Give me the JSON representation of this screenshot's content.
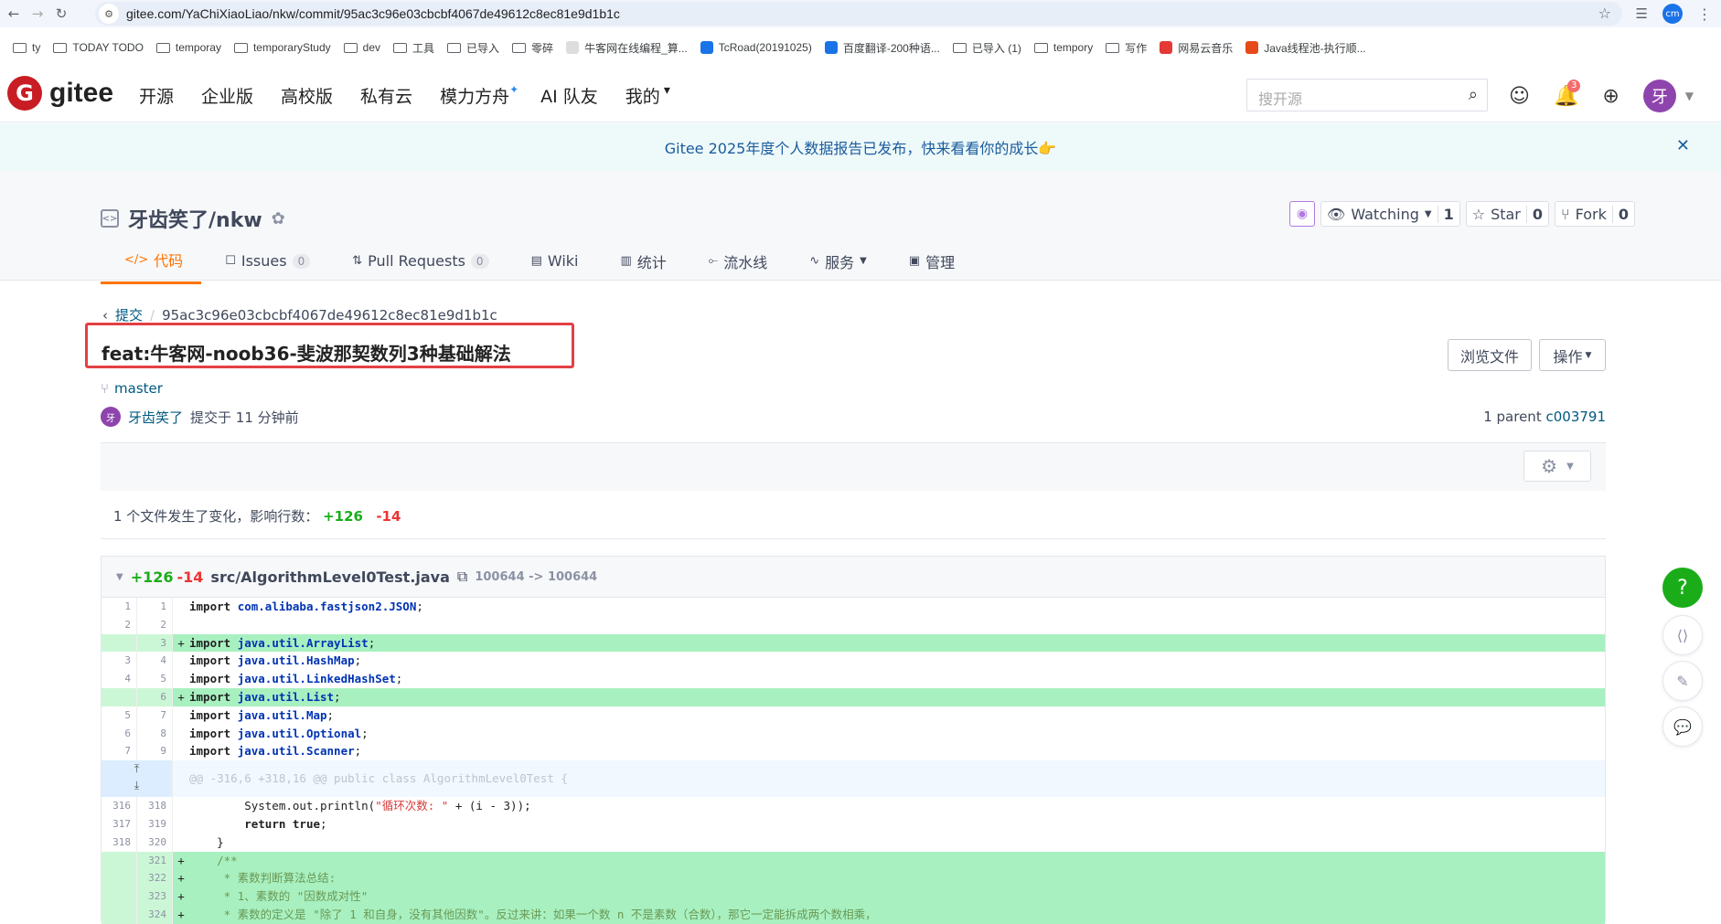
{
  "browser": {
    "url": "gitee.com/YaChiXiaoLiao/nkw/commit/95ac3c96e03cbcbf4067de49612c8ec81e9d1b1c",
    "profile": "cm",
    "bookmarks": [
      "ty",
      "TODAY TODO",
      "temporay",
      "temporaryStudy",
      "dev",
      "工具",
      "已导入",
      "零碎",
      "牛客网在线编程_算...",
      "TcRoad(20191025)",
      "百度翻译-200种语...",
      "已导入 (1)",
      "tempory",
      "写作",
      "网易云音乐",
      "Java线程池-执行顺..."
    ]
  },
  "nav": {
    "logo": "gitee",
    "items": [
      "开源",
      "企业版",
      "高校版",
      "私有云",
      "模力方舟",
      "AI 队友",
      "我的"
    ],
    "search_placeholder": "搜开源",
    "notif_count": "3",
    "user_initial": "牙"
  },
  "announce": {
    "text": "Gitee 2025年度个人数据报告已发布，快来看看你的成长👉"
  },
  "repo": {
    "title": "牙齿笑了/nkw",
    "watch_label": "Watching",
    "watch_count": "1",
    "star_label": "Star",
    "star_count": "0",
    "fork_label": "Fork",
    "fork_count": "0",
    "tabs": [
      {
        "label": "代码"
      },
      {
        "label": "Issues",
        "count": "0"
      },
      {
        "label": "Pull Requests",
        "count": "0"
      },
      {
        "label": "Wiki"
      },
      {
        "label": "统计"
      },
      {
        "label": "流水线"
      },
      {
        "label": "服务"
      },
      {
        "label": "管理"
      }
    ]
  },
  "commit": {
    "crumb_back": "提交",
    "hash": "95ac3c96e03cbcbf4067de49612c8ec81e9d1b1c",
    "title": "feat:牛客网-noob36-斐波那契数列3种基础解法",
    "browse_btn": "浏览文件",
    "ops_btn": "操作",
    "branch": "master",
    "author": "牙齿笑了",
    "author_initial": "牙",
    "time": "提交于 11 分钟前",
    "parent_label": "1 parent",
    "parent_hash": "c003791",
    "summary_prefix": "1 个文件发生了变化，影响行数：",
    "additions": "+126",
    "deletions": "-14"
  },
  "file": {
    "additions": "+126",
    "deletions": "-14",
    "path": "src/AlgorithmLevel0Test.java",
    "mode": "100644 -> 100644",
    "hunk": "@@ -316,6 +318,16 @@ public class AlgorithmLevel0Test {",
    "lines": [
      {
        "old": "1",
        "new": "1",
        "sign": "",
        "code": "import com.alibaba.fastjson2.JSON;",
        "type": "ctx"
      },
      {
        "old": "2",
        "new": "2",
        "sign": "",
        "code": "",
        "type": "ctx"
      },
      {
        "old": "",
        "new": "3",
        "sign": "+",
        "code": "import java.util.ArrayList;",
        "type": "add"
      },
      {
        "old": "3",
        "new": "4",
        "sign": "",
        "code": "import java.util.HashMap;",
        "type": "ctx"
      },
      {
        "old": "4",
        "new": "5",
        "sign": "",
        "code": "import java.util.LinkedHashSet;",
        "type": "ctx"
      },
      {
        "old": "",
        "new": "6",
        "sign": "+",
        "code": "import java.util.List;",
        "type": "add"
      },
      {
        "old": "5",
        "new": "7",
        "sign": "",
        "code": "import java.util.Map;",
        "type": "ctx"
      },
      {
        "old": "6",
        "new": "8",
        "sign": "",
        "code": "import java.util.Optional;",
        "type": "ctx"
      },
      {
        "old": "7",
        "new": "9",
        "sign": "",
        "code": "import java.util.Scanner;",
        "type": "ctx"
      }
    ],
    "lines2": [
      {
        "old": "316",
        "new": "318",
        "sign": "",
        "code": "        System.out.println(\"循环次数: \" + (i - 3));",
        "type": "ctx"
      },
      {
        "old": "317",
        "new": "319",
        "sign": "",
        "code": "        return true;",
        "type": "ctx"
      },
      {
        "old": "318",
        "new": "320",
        "sign": "",
        "code": "    }",
        "type": "ctx"
      },
      {
        "old": "",
        "new": "321",
        "sign": "+",
        "code": "    /**",
        "type": "add"
      },
      {
        "old": "",
        "new": "322",
        "sign": "+",
        "code": "     * 素数判断算法总结:",
        "type": "add"
      },
      {
        "old": "",
        "new": "323",
        "sign": "+",
        "code": "     * 1、素数的 \"因数成对性\"",
        "type": "add"
      },
      {
        "old": "",
        "new": "324",
        "sign": "+",
        "code": "     * 素数的定义是 \"除了 1 和自身，没有其他因数\"。反过来讲：如果一个数 n 不是素数（合数），那它一定能拆成两个数相乘，",
        "type": "add"
      }
    ]
  }
}
